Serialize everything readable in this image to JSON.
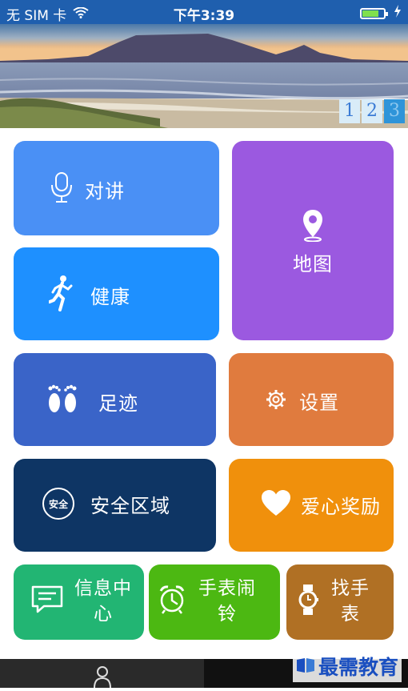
{
  "status_bar": {
    "carrier": "无 SIM 卡",
    "time": "下午3:39"
  },
  "banner": {
    "pages": [
      "1",
      "2",
      "3"
    ],
    "active_page": 3
  },
  "tiles": {
    "intercom": "对讲",
    "map": "地图",
    "health": "健康",
    "footprint": "足迹",
    "settings": "设置",
    "safe_zone": "安全区域",
    "safe_badge": "安全",
    "love_reward": "爱心奖励",
    "message_center": [
      "信息中",
      "心"
    ],
    "watch_alarm": [
      "手表闹",
      "铃"
    ],
    "find_watch": [
      "找手",
      "表"
    ]
  },
  "colors": {
    "intercom": "#4a90f5",
    "map": "#9b59e0",
    "health": "#1e90ff",
    "footprint": "#3a64c8",
    "settings": "#e07b3e",
    "safe_zone": "#0e3564",
    "love_reward": "#f0900c",
    "message_center": "#22b573",
    "watch_alarm": "#4cb812",
    "find_watch": "#b07024"
  },
  "watermark": "最需教育"
}
